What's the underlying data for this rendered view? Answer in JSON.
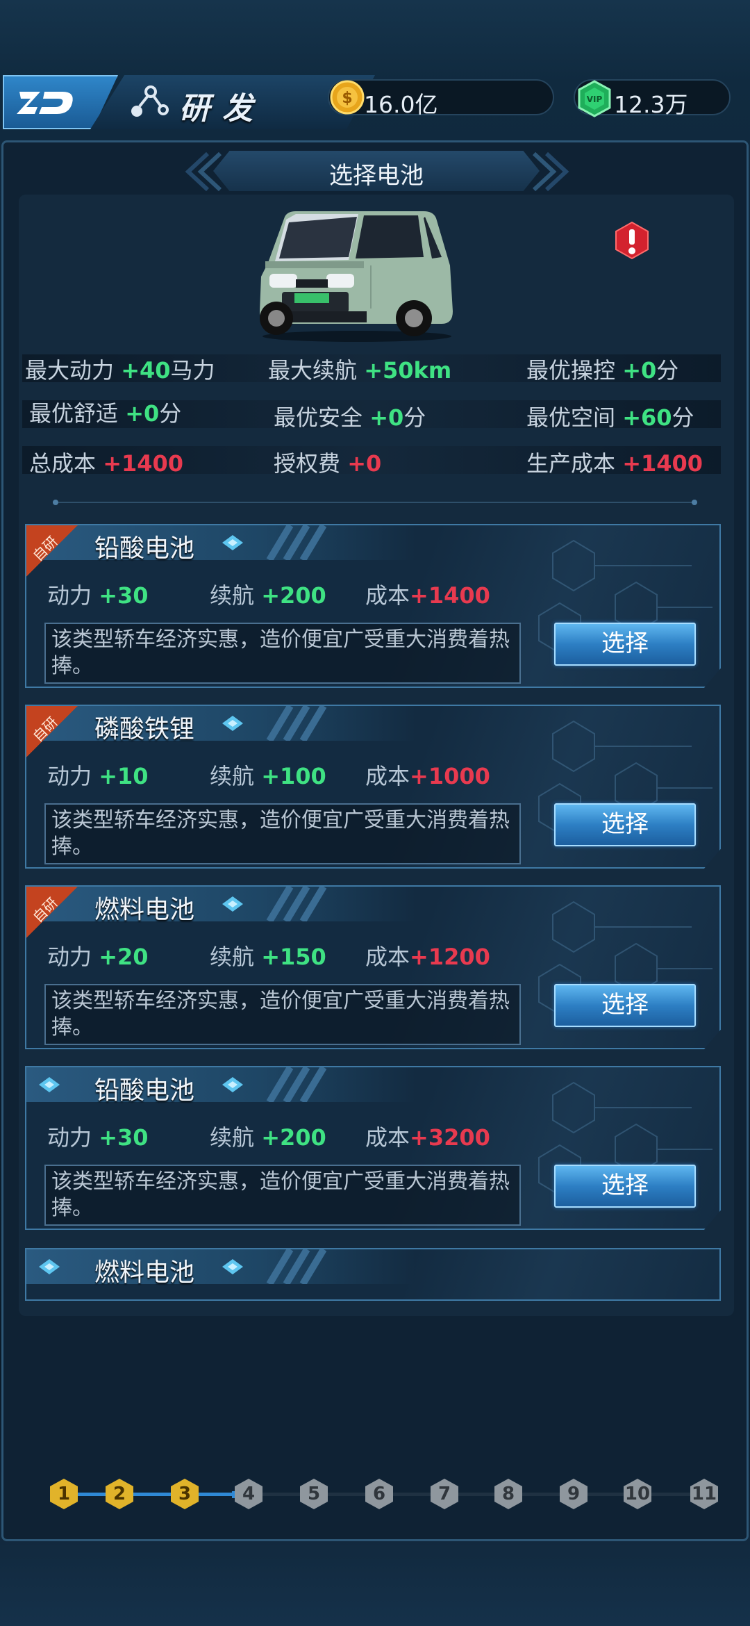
{
  "header": {
    "title": "研发",
    "coins": "16.0亿",
    "gems": "12.3万"
  },
  "panel": {
    "title": "选择电池"
  },
  "car_stats": [
    {
      "label": "最大动力",
      "value": "+40",
      "unit": "马力"
    },
    {
      "label": "最大续航",
      "value": "+50km",
      "unit": ""
    },
    {
      "label": "最优操控",
      "value": "+0",
      "unit": "分"
    },
    {
      "label": "最优舒适",
      "value": "+0",
      "unit": "分"
    },
    {
      "label": "最优安全",
      "value": "+0",
      "unit": "分"
    },
    {
      "label": "最优空间",
      "value": "+60",
      "unit": "分"
    },
    {
      "label": "总成本",
      "value": "+1400",
      "unit": ""
    },
    {
      "label": "授权费",
      "value": "+0",
      "unit": ""
    },
    {
      "label": "生产成本",
      "value": "+1400",
      "unit": ""
    }
  ],
  "batteries": [
    {
      "badge": "自研",
      "name": "铅酸电池",
      "power_label": "动力",
      "power": "+30",
      "range_label": "续航",
      "range": "+200",
      "cost_label": "成本",
      "cost": "+1400",
      "desc": "该类型轿车经济实惠，造价便宜广受重大消费着热捧。",
      "button": "选择"
    },
    {
      "badge": "自研",
      "name": "磷酸铁锂",
      "power_label": "动力",
      "power": "+10",
      "range_label": "续航",
      "range": "+100",
      "cost_label": "成本",
      "cost": "+1000",
      "desc": "该类型轿车经济实惠，造价便宜广受重大消费着热捧。",
      "button": "选择"
    },
    {
      "badge": "自研",
      "name": "燃料电池",
      "power_label": "动力",
      "power": "+20",
      "range_label": "续航",
      "range": "+150",
      "cost_label": "成本",
      "cost": "+1200",
      "desc": "该类型轿车经济实惠，造价便宜广受重大消费着热捧。",
      "button": "选择"
    },
    {
      "badge": "",
      "name": "铅酸电池",
      "power_label": "动力",
      "power": "+30",
      "range_label": "续航",
      "range": "+200",
      "cost_label": "成本",
      "cost": "+3200",
      "desc": "该类型轿车经济实惠，造价便宜广受重大消费着热捧。",
      "button": "选择"
    },
    {
      "badge": "",
      "name": "燃料电池"
    }
  ],
  "steps": {
    "labels": [
      "1",
      "2",
      "3",
      "4",
      "5",
      "6",
      "7",
      "8",
      "9",
      "10",
      "11"
    ],
    "completed": 3
  },
  "colors": {
    "positive": "#3fe283",
    "negative": "#e83a4f",
    "step_done": "#e1b32a",
    "step_todo": "#8f979e"
  }
}
